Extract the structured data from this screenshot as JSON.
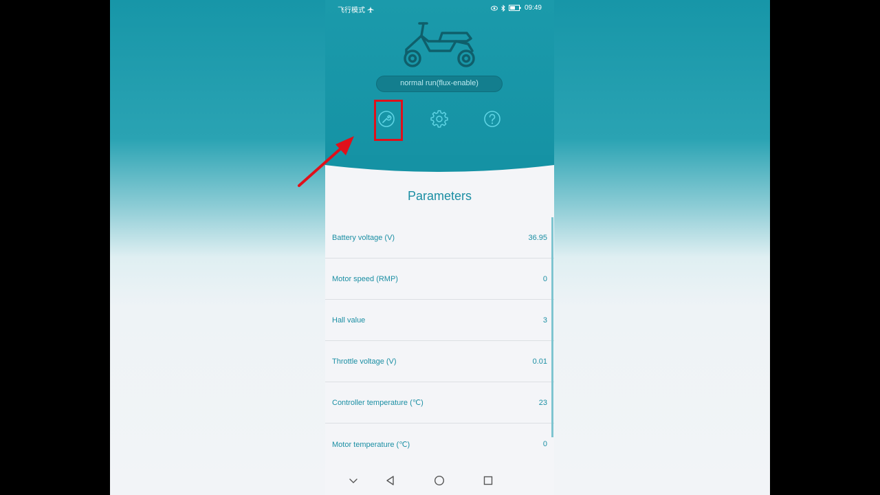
{
  "status_bar": {
    "left_text": "飞行模式",
    "left_icon": "airplane-icon",
    "time": "09:49",
    "icons": [
      "eye-icon",
      "bluetooth-icon",
      "battery-icon"
    ]
  },
  "header": {
    "hero_icon": "scooter-icon",
    "mode_label": "normal run(flux-enable)",
    "actions": [
      {
        "name": "wrench-icon",
        "highlighted": true
      },
      {
        "name": "gear-icon"
      },
      {
        "name": "help-icon"
      }
    ],
    "expand_icon": "chevron-down-icon"
  },
  "parameters": {
    "title": "Parameters",
    "rows": [
      {
        "label": "Battery voltage (V)",
        "value": "36.95"
      },
      {
        "label": "Motor speed (RMP)",
        "value": "0"
      },
      {
        "label": "Hall value",
        "value": "3"
      },
      {
        "label": "Throttle voltage (V)",
        "value": "0.01"
      },
      {
        "label": "Controller temperature (℃)",
        "value": "23"
      },
      {
        "label": "Motor temperature (℃)",
        "value": "0"
      }
    ]
  },
  "nav_bar": {
    "buttons": [
      "hide-keyboard-icon",
      "back-icon",
      "home-icon",
      "recent-apps-icon"
    ]
  },
  "annotations": {
    "arrow": "red-arrow-icon",
    "highlight": "red-highlight-box"
  },
  "colors": {
    "header_teal": "#1592a4",
    "accent_text": "#1a8ea3",
    "highlight_red": "#e0101a",
    "list_background": "#f4f5f8"
  }
}
